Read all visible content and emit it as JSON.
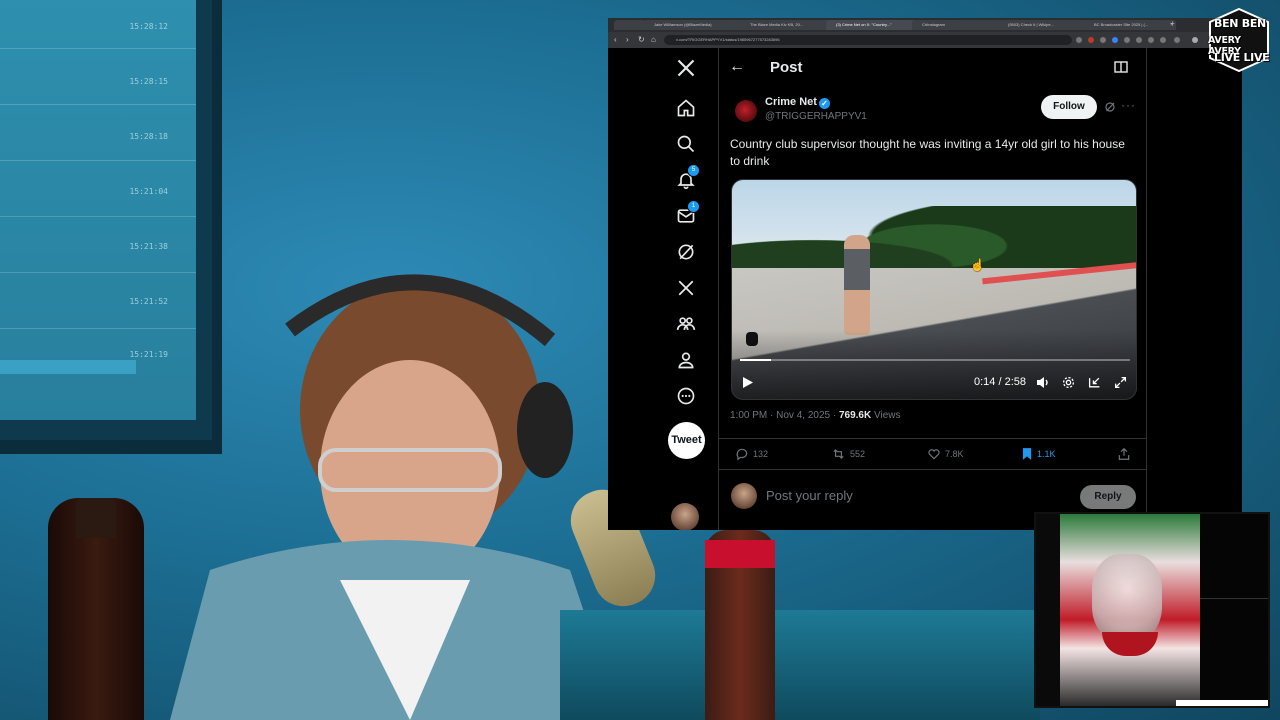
{
  "wall_monitor": {
    "times": [
      "15:28:12",
      "15:28:15",
      "15:28:18",
      "15:21:04",
      "15:21:38",
      "15:21:52",
      "15:21:19"
    ]
  },
  "browser": {
    "tabs": [
      {
        "label": ""
      },
      {
        "label": "Jake Williamson (@BlazeMedia)"
      },
      {
        "label": "The Blaze Media Kiv KB, 20..."
      },
      {
        "label": "(3) Crime Net on X: \"Country...\"",
        "active": true
      },
      {
        "label": "ChInstagram"
      },
      {
        "label": "(5503) Check It | Wikipe..."
      },
      {
        "label": "BC Broadcaster Site 2025 | (..."
      }
    ],
    "url": "x.com/TRIGGERHAPPYV1/status/1985967277573283696"
  },
  "x": {
    "nav": [
      {
        "name": "x-logo-icon",
        "glyph": "𝕏"
      },
      {
        "name": "home-icon",
        "glyph": ""
      },
      {
        "name": "search-icon",
        "glyph": ""
      },
      {
        "name": "notifications-icon",
        "badge": "5"
      },
      {
        "name": "messages-icon",
        "badge": "1"
      },
      {
        "name": "grok-icon"
      },
      {
        "name": "premium-x-icon",
        "glyph": "𝕏"
      },
      {
        "name": "communities-icon"
      },
      {
        "name": "profile-icon"
      },
      {
        "name": "more-icon"
      }
    ],
    "tweet_button": "Tweet",
    "header": {
      "title": "Post"
    },
    "author": {
      "name": "Crime Net",
      "handle": "@TRIGGERHAPPYV1",
      "verified_color": "#1d9bf0"
    },
    "follow_label": "Follow",
    "text": "Country club supervisor thought he was inviting a 14yr old girl to his house to drink",
    "video": {
      "time": "0:14 / 2:58",
      "progress": 0.08
    },
    "meta": {
      "time": "1:00 PM",
      "date": "Nov 4, 2025",
      "views": "769.6K",
      "views_label": "Views"
    },
    "actions": {
      "replies": "132",
      "reposts": "552",
      "likes": "7.8K",
      "bookmarks": "1.1K"
    },
    "reply": {
      "placeholder": "Post your reply",
      "button": "Reply"
    }
  },
  "logo": {
    "lines": [
      "BEN BEN",
      "AVERY AVERY",
      "LIVE LIVE"
    ]
  },
  "colors": {
    "accent": "#1d9bf0",
    "background": "#000000",
    "text": "#e7e9ea",
    "muted": "#71767b"
  }
}
